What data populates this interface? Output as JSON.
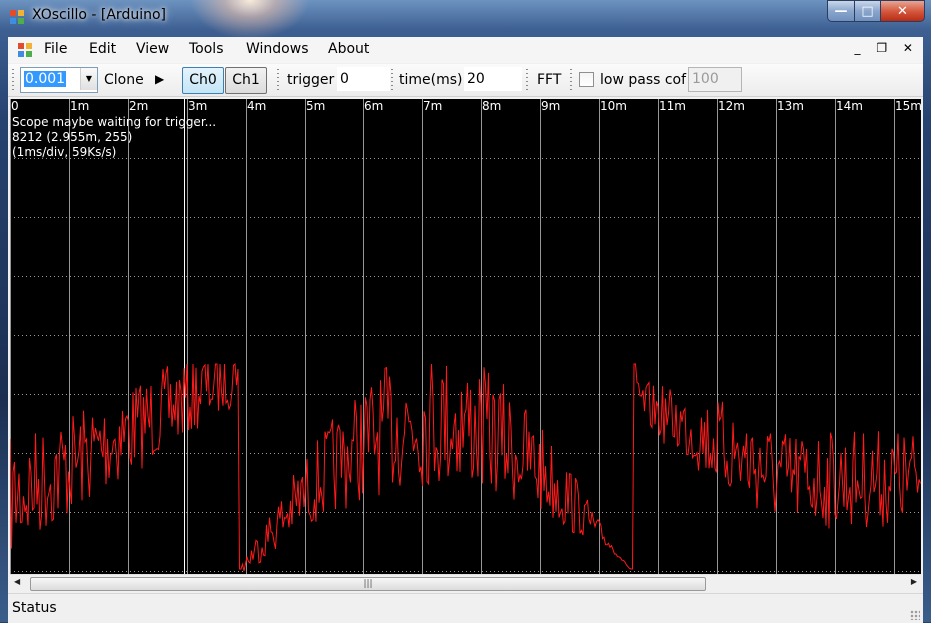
{
  "window": {
    "title": "XOscillo - [Arduino]",
    "buttons": {
      "minimize": "—",
      "maximize": "□",
      "close": "✕"
    }
  },
  "menu": {
    "items": [
      "File",
      "Edit",
      "View",
      "Tools",
      "Windows",
      "About"
    ],
    "mdi_controls": "_ ❐ ✕"
  },
  "toolbar": {
    "scale_value": "0.001",
    "clone_label": "Clone",
    "play_icon": "▶",
    "ch0_label": "Ch0",
    "ch1_label": "Ch1",
    "trigger_label": "trigger",
    "trigger_value": "0",
    "time_label": "time(ms)",
    "time_value": "20",
    "fft_label": "FFT",
    "lowpass_label": "low pass cof",
    "lowpass_checked": false,
    "lowpass_value": "100"
  },
  "scope": {
    "tick_labels": [
      "0",
      "1m",
      "2m",
      "3m",
      "4m",
      "5m",
      "6m",
      "7m",
      "8m",
      "9m",
      "10m",
      "11m",
      "12m",
      "13m",
      "14m",
      "15m"
    ],
    "info_lines": [
      "Scope maybe waiting for trigger...",
      "8212 (2.955m, 255)",
      "(1ms/div, 59Ks/s)"
    ],
    "trace_color": "#ff1a1a",
    "grid_color": "#c8c8c8"
  },
  "status": {
    "text": "Status"
  }
}
